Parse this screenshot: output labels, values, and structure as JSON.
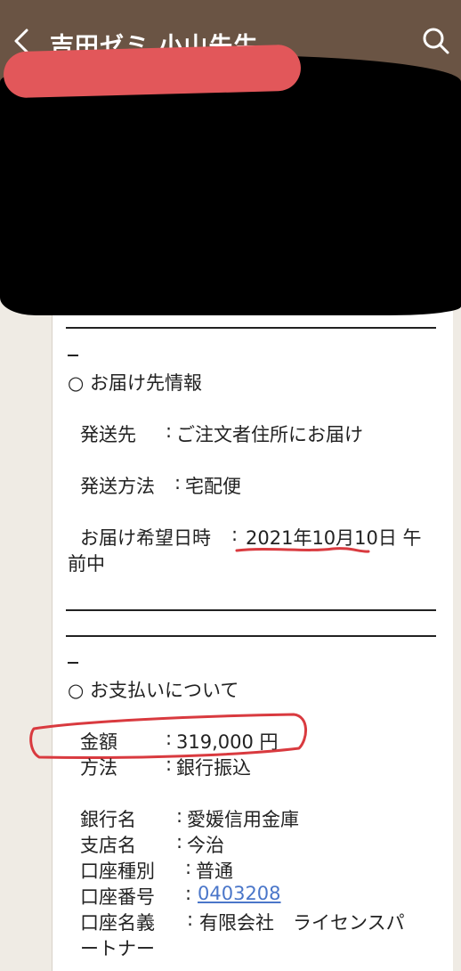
{
  "header": {
    "title": "吉田ゼミ  小山先生"
  },
  "delivery": {
    "section_title": "○ お届け先情報",
    "ship_to_label": "発送先",
    "ship_to_sep": ":",
    "ship_to_value": "ご注文者住所にお届け",
    "method_label": "発送方法",
    "method_sep": ":",
    "method_value": "宅配便",
    "date_label": "お届け希望日時",
    "date_sep": ":",
    "date_value": "2021年10月10日 午",
    "date_value_cont": "前中"
  },
  "payment": {
    "section_title": "○ お支払いについて",
    "amount_label": "金額",
    "amount_sep": ":",
    "amount_value": "319,000 円",
    "method_label": "方法",
    "method_sep": ":",
    "method_value": "銀行振込",
    "bank_label": "銀行名",
    "bank_sep": ":",
    "bank_value": "愛媛信用金庫",
    "branch_label": "支店名",
    "branch_sep": ":",
    "branch_value": "今治",
    "account_type_label": "口座種別",
    "account_type_sep": ":",
    "account_type_value": "普通",
    "account_no_label": "口座番号",
    "account_no_sep": ":",
    "account_no_value": "0403208",
    "holder_label": "口座名義",
    "holder_sep": ":",
    "holder_value": "有限会社　ライセンスパ",
    "holder_value_cont": "ートナー"
  },
  "colors": {
    "header_bg": "#6a5444",
    "background": "#efebe4",
    "annotation_red": "#d93a3f",
    "link": "#4a76c9"
  }
}
